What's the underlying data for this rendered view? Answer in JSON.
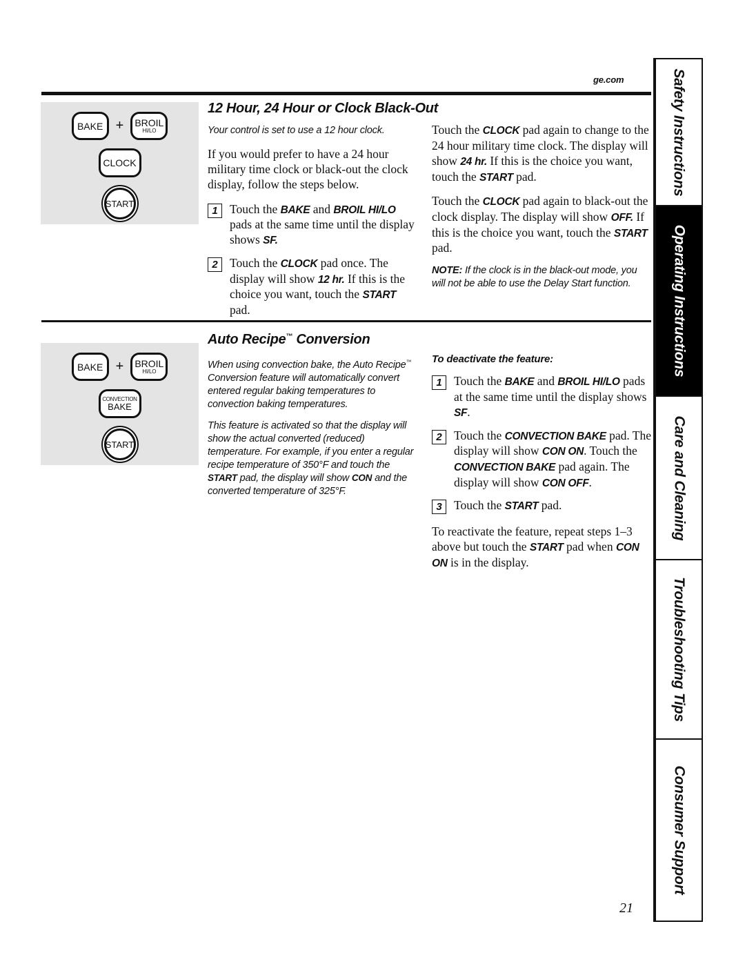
{
  "header": {
    "brand": "ge.com",
    "page_number": "21"
  },
  "sections": [
    {
      "heading": "12 Hour, 24 Hour or Clock Black-Out",
      "keypad": {
        "row1": {
          "key_a": "BAKE",
          "operator": "+",
          "key_b_main": "BROIL",
          "key_b_sub": "HI/LO"
        },
        "row2": {
          "key": "CLOCK"
        },
        "row3": {
          "key": "START"
        }
      }
    },
    {
      "heading": "Auto Recipe™ Conversion",
      "heading_base": "Auto Recipe",
      "heading_tm": "™",
      "heading_tail": " Conversion",
      "keypad": {
        "row1": {
          "key_a": "BAKE",
          "operator": "+",
          "key_b_main": "BROIL",
          "key_b_sub": "HI/LO"
        },
        "row2": {
          "key_sup": "CONVECTION",
          "key_main": "BAKE"
        },
        "row3": {
          "key": "START"
        }
      }
    }
  ],
  "section1": {
    "lead_italic": "Your control is set to use a 12 hour clock.",
    "intro": "If you would prefer to have a 24 hour military time clock or black-out the clock display, follow the steps below.",
    "steps": [
      {
        "num": "1",
        "text": "Touch the BAKE and BROIL HI/LO pads at the same time until the display shows SF."
      },
      {
        "num": "2",
        "text": "Touch the CLOCK pad once. The display will show 12 hr. If this is the choice you want, touch the START pad."
      }
    ],
    "right_para_1": "Touch the CLOCK pad again to change to the 24 hour military time clock. The display will show 24 hr. If this is the choice you want, touch the START pad.",
    "right_para_2": "Touch the CLOCK pad again to black-out the clock display. The display will show OFF. If this is the choice you want, touch the START pad.",
    "note_label": "NOTE:",
    "note_text": " If the clock is in the black-out mode, you will not be able to use the Delay Start function."
  },
  "section2": {
    "para_1": "When using convection bake, the Auto Recipe™ Conversion feature will automatically convert entered regular baking temperatures to convection baking temperatures.",
    "para_2": "This feature is activated so that the display will show the actual converted (reduced) temperature. For example, if you enter a regular recipe temperature of 350°F and touch the START pad, the display will show CON and the converted temperature of 325°F.",
    "deactivate_heading": "To deactivate the feature:",
    "steps": [
      {
        "num": "1",
        "text": "Touch the BAKE and BROIL HI/LO pads at the same time until the display shows SF."
      },
      {
        "num": "2",
        "text": "Touch the CONVECTION BAKE pad. The display will show CON ON. Touch the CONVECTION BAKE pad again. The display will show CON OFF."
      },
      {
        "num": "3",
        "text": "Touch the START pad."
      }
    ],
    "reactivate": "To reactivate the feature, repeat steps 1–3 above but touch the START pad when CON ON is in the display."
  },
  "sidebar": {
    "tabs": [
      {
        "label": "Safety Instructions",
        "active": false
      },
      {
        "label": "Operating Instructions",
        "active": true
      },
      {
        "label": "Care and Cleaning",
        "active": false
      },
      {
        "label": "Troubleshooting Tips",
        "active": false
      },
      {
        "label": "Consumer Support",
        "active": false
      }
    ]
  }
}
